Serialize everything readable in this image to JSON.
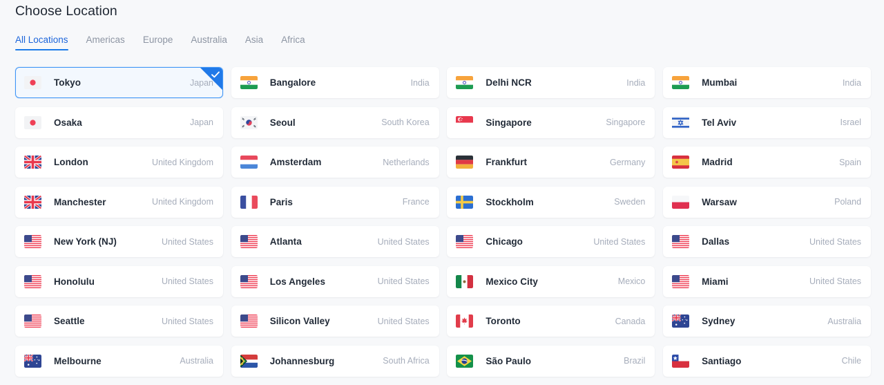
{
  "header": {
    "title": "Choose Location"
  },
  "tabs": [
    {
      "label": "All Locations",
      "active": true
    },
    {
      "label": "Americas",
      "active": false
    },
    {
      "label": "Europe",
      "active": false
    },
    {
      "label": "Australia",
      "active": false
    },
    {
      "label": "Asia",
      "active": false
    },
    {
      "label": "Africa",
      "active": false
    }
  ],
  "colors": {
    "accent": "#1b7ae8",
    "selected_border": "#3d94f6",
    "selected_bg": "#f3f8fe",
    "badge": "#2079e8",
    "page_bg": "#f7f8fa",
    "card_bg": "#ffffff",
    "city_text": "#222b38",
    "country_text": "#a6adbb",
    "tab_inactive": "#8d95a3",
    "title_text": "#1f2733"
  },
  "locations": [
    {
      "city": "Tokyo",
      "country": "Japan",
      "flag": "jp",
      "flag_name": "flag-japan",
      "selected": true
    },
    {
      "city": "Bangalore",
      "country": "India",
      "flag": "in",
      "flag_name": "flag-india",
      "selected": false
    },
    {
      "city": "Delhi NCR",
      "country": "India",
      "flag": "in",
      "flag_name": "flag-india",
      "selected": false
    },
    {
      "city": "Mumbai",
      "country": "India",
      "flag": "in",
      "flag_name": "flag-india",
      "selected": false
    },
    {
      "city": "Osaka",
      "country": "Japan",
      "flag": "jp",
      "flag_name": "flag-japan",
      "selected": false
    },
    {
      "city": "Seoul",
      "country": "South Korea",
      "flag": "kr",
      "flag_name": "flag-south-korea",
      "selected": false
    },
    {
      "city": "Singapore",
      "country": "Singapore",
      "flag": "sg",
      "flag_name": "flag-singapore",
      "selected": false
    },
    {
      "city": "Tel Aviv",
      "country": "Israel",
      "flag": "il",
      "flag_name": "flag-israel",
      "selected": false
    },
    {
      "city": "London",
      "country": "United Kingdom",
      "flag": "gb",
      "flag_name": "flag-united-kingdom",
      "selected": false
    },
    {
      "city": "Amsterdam",
      "country": "Netherlands",
      "flag": "nl",
      "flag_name": "flag-netherlands",
      "selected": false
    },
    {
      "city": "Frankfurt",
      "country": "Germany",
      "flag": "de",
      "flag_name": "flag-germany",
      "selected": false
    },
    {
      "city": "Madrid",
      "country": "Spain",
      "flag": "es",
      "flag_name": "flag-spain",
      "selected": false
    },
    {
      "city": "Manchester",
      "country": "United Kingdom",
      "flag": "gb",
      "flag_name": "flag-united-kingdom",
      "selected": false
    },
    {
      "city": "Paris",
      "country": "France",
      "flag": "fr",
      "flag_name": "flag-france",
      "selected": false
    },
    {
      "city": "Stockholm",
      "country": "Sweden",
      "flag": "se",
      "flag_name": "flag-sweden",
      "selected": false
    },
    {
      "city": "Warsaw",
      "country": "Poland",
      "flag": "pl",
      "flag_name": "flag-poland",
      "selected": false
    },
    {
      "city": "New York (NJ)",
      "country": "United States",
      "flag": "us",
      "flag_name": "flag-united-states",
      "selected": false
    },
    {
      "city": "Atlanta",
      "country": "United States",
      "flag": "us",
      "flag_name": "flag-united-states",
      "selected": false
    },
    {
      "city": "Chicago",
      "country": "United States",
      "flag": "us",
      "flag_name": "flag-united-states",
      "selected": false
    },
    {
      "city": "Dallas",
      "country": "United States",
      "flag": "us",
      "flag_name": "flag-united-states",
      "selected": false
    },
    {
      "city": "Honolulu",
      "country": "United States",
      "flag": "us",
      "flag_name": "flag-united-states",
      "selected": false
    },
    {
      "city": "Los Angeles",
      "country": "United States",
      "flag": "us",
      "flag_name": "flag-united-states",
      "selected": false
    },
    {
      "city": "Mexico City",
      "country": "Mexico",
      "flag": "mx",
      "flag_name": "flag-mexico",
      "selected": false
    },
    {
      "city": "Miami",
      "country": "United States",
      "flag": "us",
      "flag_name": "flag-united-states",
      "selected": false
    },
    {
      "city": "Seattle",
      "country": "United States",
      "flag": "us",
      "flag_name": "flag-united-states",
      "selected": false
    },
    {
      "city": "Silicon Valley",
      "country": "United States",
      "flag": "us",
      "flag_name": "flag-united-states",
      "selected": false
    },
    {
      "city": "Toronto",
      "country": "Canada",
      "flag": "ca",
      "flag_name": "flag-canada",
      "selected": false
    },
    {
      "city": "Sydney",
      "country": "Australia",
      "flag": "au",
      "flag_name": "flag-australia",
      "selected": false
    },
    {
      "city": "Melbourne",
      "country": "Australia",
      "flag": "au",
      "flag_name": "flag-australia",
      "selected": false
    },
    {
      "city": "Johannesburg",
      "country": "South Africa",
      "flag": "za",
      "flag_name": "flag-south-africa",
      "selected": false
    },
    {
      "city": "São Paulo",
      "country": "Brazil",
      "flag": "br",
      "flag_name": "flag-brazil",
      "selected": false
    },
    {
      "city": "Santiago",
      "country": "Chile",
      "flag": "cl",
      "flag_name": "flag-chile",
      "selected": false
    }
  ]
}
